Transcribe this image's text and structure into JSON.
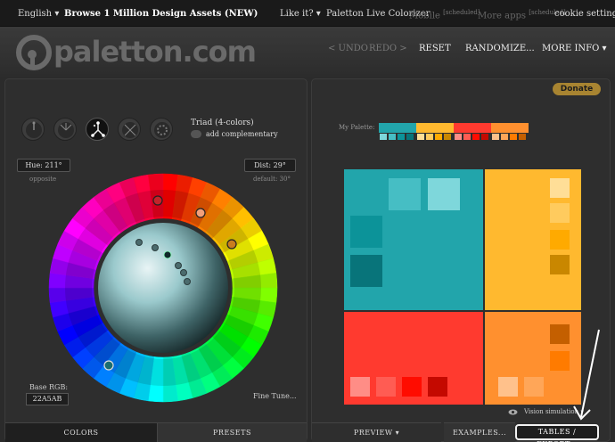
{
  "topbar": {
    "language": "English",
    "language_caret": "▾",
    "browse": "Browse 1 Million Design Assets (NEW)",
    "like_it": "Like it?",
    "like_it_caret": "▾",
    "live_colorizer": "Paletton Live Colorizer",
    "mobile": "Mobile",
    "mobile_tag": "[scheduled]",
    "more_apps": "More apps",
    "more_apps_tag": "[scheduled]",
    "cookie_settings": "cookie settings"
  },
  "header": {
    "logo_text": "paletton.com",
    "undo": "< UNDO",
    "redo": "REDO >",
    "reset": "RESET",
    "randomize": "RANDOMIZE...",
    "more_info": "MORE INFO",
    "more_info_caret": "▾"
  },
  "donate": {
    "label": "Donate"
  },
  "scheme": {
    "label": "Triad (4-colors)",
    "add_complementary": "add complementary",
    "selected_index": 2
  },
  "hue": {
    "label": "Hue: 211°",
    "sub": "opposite"
  },
  "dist": {
    "label": "Dist: 29°",
    "sub": "default: 30°"
  },
  "base_rgb": {
    "label": "Base RGB:",
    "value": "22A5AB"
  },
  "fine_tune": "Fine Tune...",
  "left_tabs": {
    "colors": "COLORS",
    "presets": "PRESETS"
  },
  "my_palette": {
    "label": "My Palette:",
    "groups": [
      {
        "main": "#22A5AB",
        "chips": [
          "#7ED7DB",
          "#46BEC4",
          "#0C9399",
          "#08747A"
        ]
      },
      {
        "main": "#FFB92F",
        "chips": [
          "#FFDE97",
          "#FFCB5E",
          "#FFAA00",
          "#C98700"
        ]
      },
      {
        "main": "#FF3A2F",
        "chips": [
          "#FF8D86",
          "#FF5C53",
          "#FF0C00",
          "#C40900"
        ]
      },
      {
        "main": "#FF902F",
        "chips": [
          "#FFC18B",
          "#FFA658",
          "#FF7B00",
          "#C45F00"
        ]
      }
    ]
  },
  "preview_colors": {
    "teal": {
      "main": "#22A5AB",
      "light1": "#7ED7DB",
      "light2": "#46BEC4",
      "dark1": "#0C9399",
      "dark2": "#08747A"
    },
    "yellow": {
      "main": "#FFB92F",
      "light1": "#FFDE97",
      "light2": "#FFCB5E",
      "dark1": "#FFAA00",
      "dark2": "#C98700"
    },
    "red": {
      "main": "#FF3A2F",
      "light1": "#FF8D86",
      "light2": "#FF5C53",
      "dark1": "#FF0C00",
      "dark2": "#C40900"
    },
    "orange": {
      "main": "#FF902F",
      "light1": "#FFC18B",
      "light2": "#FFA658",
      "dark1": "#FF7B00",
      "dark2": "#C45F00"
    }
  },
  "vision_simulation": "Vision simulation",
  "vision_caret": "▾",
  "right_tabs": {
    "preview": "PREVIEW",
    "preview_caret": "▾",
    "examples": "EXAMPLES...",
    "tables_export": "TABLES / EXPORT..."
  }
}
